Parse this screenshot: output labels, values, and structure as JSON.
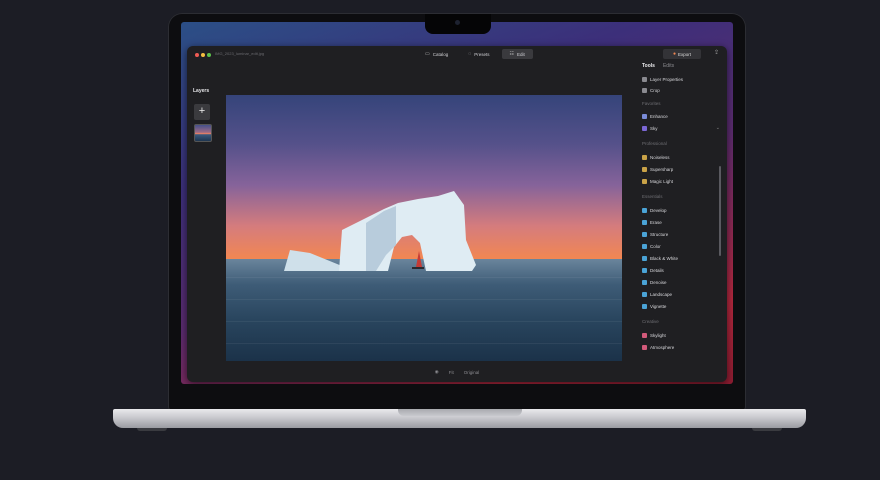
{
  "titlebar": {
    "filename": "IMG_2023_luminar_edit.jpg",
    "tabs": [
      {
        "icon": "catalog-icon",
        "label": "Catalog"
      },
      {
        "icon": "presets-icon",
        "label": "Presets"
      },
      {
        "icon": "edit-icon",
        "label": "Edit",
        "active": true
      }
    ],
    "export_label": "Export"
  },
  "layers": {
    "title": "Layers"
  },
  "bottom_bar": {
    "eye": "◉",
    "zoom": "Fit",
    "compare": "Original"
  },
  "panel": {
    "tabs": [
      "Tools",
      "Edits"
    ],
    "top_items": [
      "Layer Properties",
      "Crop"
    ],
    "sections": [
      {
        "name": "Favorites",
        "items": [
          "Enhance",
          "Sky"
        ]
      },
      {
        "name": "Professional",
        "items": [
          "Noiseless",
          "Supersharp",
          "Magic Light"
        ]
      },
      {
        "name": "Essentials",
        "items": [
          "Develop",
          "Erase",
          "Structure",
          "Color",
          "Black & White",
          "Details",
          "Denoise",
          "Landscape",
          "Vignette"
        ]
      },
      {
        "name": "Creative",
        "items": [
          "Skylight",
          "Atmosphere"
        ]
      }
    ]
  },
  "colors": {
    "app_bg": "#1f1f22",
    "accent": "#f28752"
  }
}
